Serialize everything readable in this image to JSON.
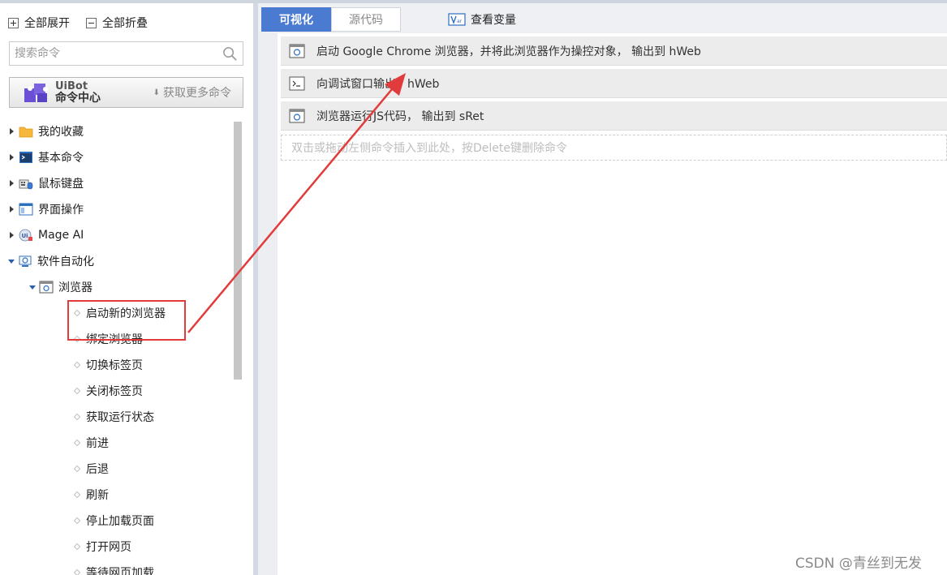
{
  "left_panel": {
    "expand_all": "全部展开",
    "collapse_all": "全部折叠",
    "search_placeholder": "搜索命令",
    "command_center": {
      "logo_line1": "UiBot",
      "logo_line2": "命令中心",
      "get_more": "获取更多命令"
    },
    "tree": {
      "favorites": "我的收藏",
      "basic": "基本命令",
      "mouse_keyboard": "鼠标键盘",
      "ui_ops": "界面操作",
      "mage_ai": "Mage AI",
      "software_automation": "软件自动化",
      "browser": "浏览器",
      "children": [
        "启动新的浏览器",
        "绑定浏览器",
        "切换标签页",
        "关闭标签页",
        "获取运行状态",
        "前进",
        "后退",
        "刷新",
        "停止加载页面",
        "打开网页",
        "等待网页加载"
      ]
    }
  },
  "editor": {
    "tabs": {
      "visual": "可视化",
      "source": "源代码"
    },
    "view_variables": "查看变量",
    "commands": [
      "启动 Google Chrome 浏览器，并将此浏览器作为操控对象， 输出到 hWeb",
      "向调试窗口输出：hWeb",
      "浏览器运行JS代码， 输出到 sRet"
    ],
    "drop_hint": "双击或拖动左侧命令插入到此处，按Delete键删除命令"
  },
  "watermark": "CSDN @青丝到无发",
  "colors": {
    "accent": "#4b7bd0",
    "annotation": "#e23b3b"
  }
}
